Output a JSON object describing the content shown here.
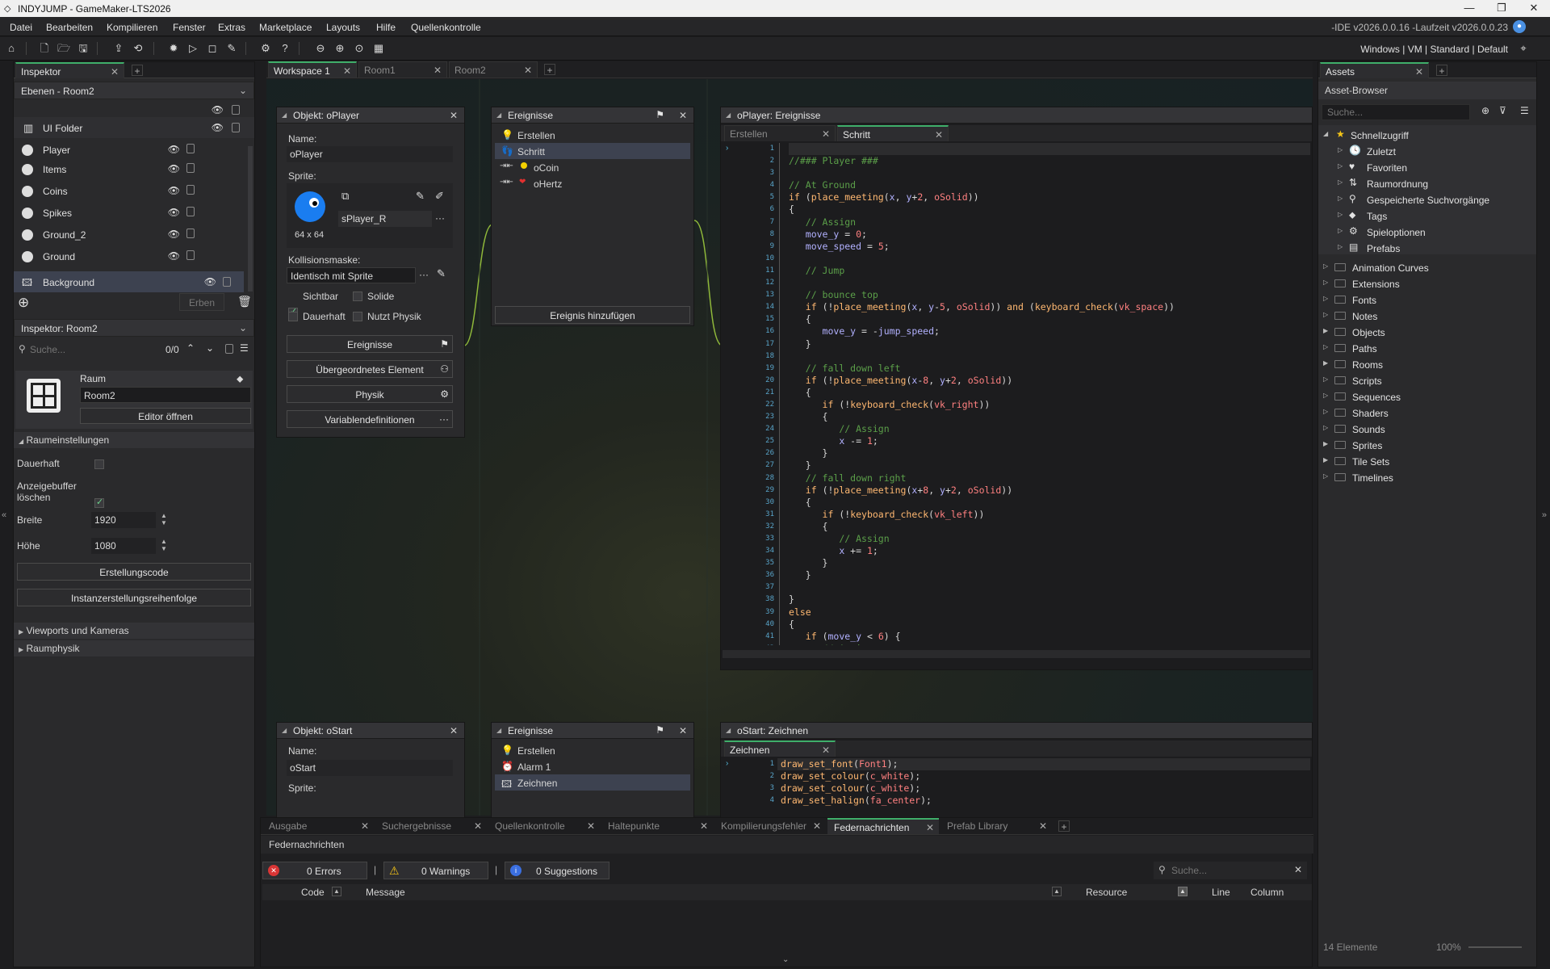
{
  "window": {
    "title": "INDYJUMP - GameMaker-LTS2026"
  },
  "menu": {
    "items": [
      "Datei",
      "Bearbeiten",
      "Kompilieren",
      "Fenster",
      "Extras",
      "Marketplace",
      "Layouts",
      "Hilfe",
      "Quellenkontrolle"
    ],
    "version": "-IDE v2026.0.0.16 -Laufzeit v2026.0.0.23"
  },
  "toolbar": {
    "target": "Windows | VM | Standard | Default"
  },
  "inspector": {
    "tab": "Inspektor",
    "layers_dropdown": "Ebenen - Room2",
    "ui_folder": "UI Folder",
    "layers": [
      "Player",
      "Items",
      "Coins",
      "Spikes",
      "Ground_2",
      "Ground",
      "Background"
    ],
    "inherit_button": "Erben",
    "room_dropdown": "Inspektor: Room2",
    "search_placeholder": "Suche...",
    "search_count": "0/0",
    "room_label": "Raum",
    "room_name": "Room2",
    "open_editor": "Editor öffnen",
    "room_settings": "Raumeinstellungen",
    "persistent": "Dauerhaft",
    "clear_buffer": "Anzeigebuffer löschen",
    "width_label": "Breite",
    "width": "1920",
    "height_label": "Höhe",
    "height": "1080",
    "creation_code": "Erstellungscode",
    "instance_order": "Instanzerstellungsreihenfolge",
    "viewports": "Viewports und Kameras",
    "physics": "Raumphysik"
  },
  "workspace": {
    "tabs": [
      "Workspace 1",
      "Room1",
      "Room2"
    ]
  },
  "oplayer": {
    "title": "Objekt: oPlayer",
    "name_label": "Name:",
    "name": "oPlayer",
    "sprite_label": "Sprite:",
    "sprite_name": "sPlayer_R",
    "sprite_size": "64 x 64",
    "mask_label": "Kollisionsmaske:",
    "mask": "Identisch mit Sprite",
    "visible": "Sichtbar",
    "solid": "Solide",
    "persistent": "Dauerhaft",
    "physics": "Nutzt Physik",
    "events_btn": "Ereignisse",
    "parent_btn": "Übergeordnetes Element",
    "physics_btn": "Physik",
    "vars_btn": "Variablendefinitionen"
  },
  "events1": {
    "title": "Ereignisse",
    "items": [
      "Erstellen",
      "Schritt",
      "oCoin",
      "oHertz"
    ],
    "add": "Ereignis hinzufügen"
  },
  "code1": {
    "title": "oPlayer: Ereignisse",
    "tabs": [
      "Erstellen",
      "Schritt"
    ]
  },
  "ostart": {
    "title": "Objekt: oStart",
    "name_label": "Name:",
    "name": "oStart",
    "sprite_label": "Sprite:"
  },
  "events2": {
    "title": "Ereignisse",
    "items": [
      "Erstellen",
      "Alarm 1",
      "Zeichnen"
    ]
  },
  "code2": {
    "title": "oStart: Zeichnen",
    "tab": "Zeichnen"
  },
  "bottom": {
    "tabs": [
      "Ausgabe",
      "Suchergebnisse",
      "Quellenkontrolle",
      "Haltepunkte",
      "Kompilierungsfehler",
      "Federnachrichten",
      "Prefab Library"
    ],
    "header": "Federnachrichten",
    "errors": "0 Errors",
    "warnings": "0 Warnings",
    "suggestions": "0 Suggestions",
    "search_placeholder": "Suche...",
    "cols": {
      "code": "Code",
      "message": "Message",
      "resource": "Resource",
      "line": "Line",
      "column": "Column"
    }
  },
  "assets": {
    "tab": "Assets",
    "header": "Asset-Browser",
    "search_placeholder": "Suche...",
    "quick": "Schnellzugriff",
    "quick_items": [
      "Zuletzt",
      "Favoriten",
      "Raumordnung",
      "Gespeicherte Suchvorgänge",
      "Tags",
      "Spieloptionen",
      "Prefabs"
    ],
    "folders": [
      "Animation Curves",
      "Extensions",
      "Fonts",
      "Notes",
      "Objects",
      "Paths",
      "Rooms",
      "Scripts",
      "Sequences",
      "Shaders",
      "Sounds",
      "Sprites",
      "Tile Sets",
      "Timelines"
    ],
    "count": "14 Elemente",
    "zoom": "100%"
  },
  "colors": {
    "accent": "#3fae6a",
    "selection": "#3d4250"
  }
}
